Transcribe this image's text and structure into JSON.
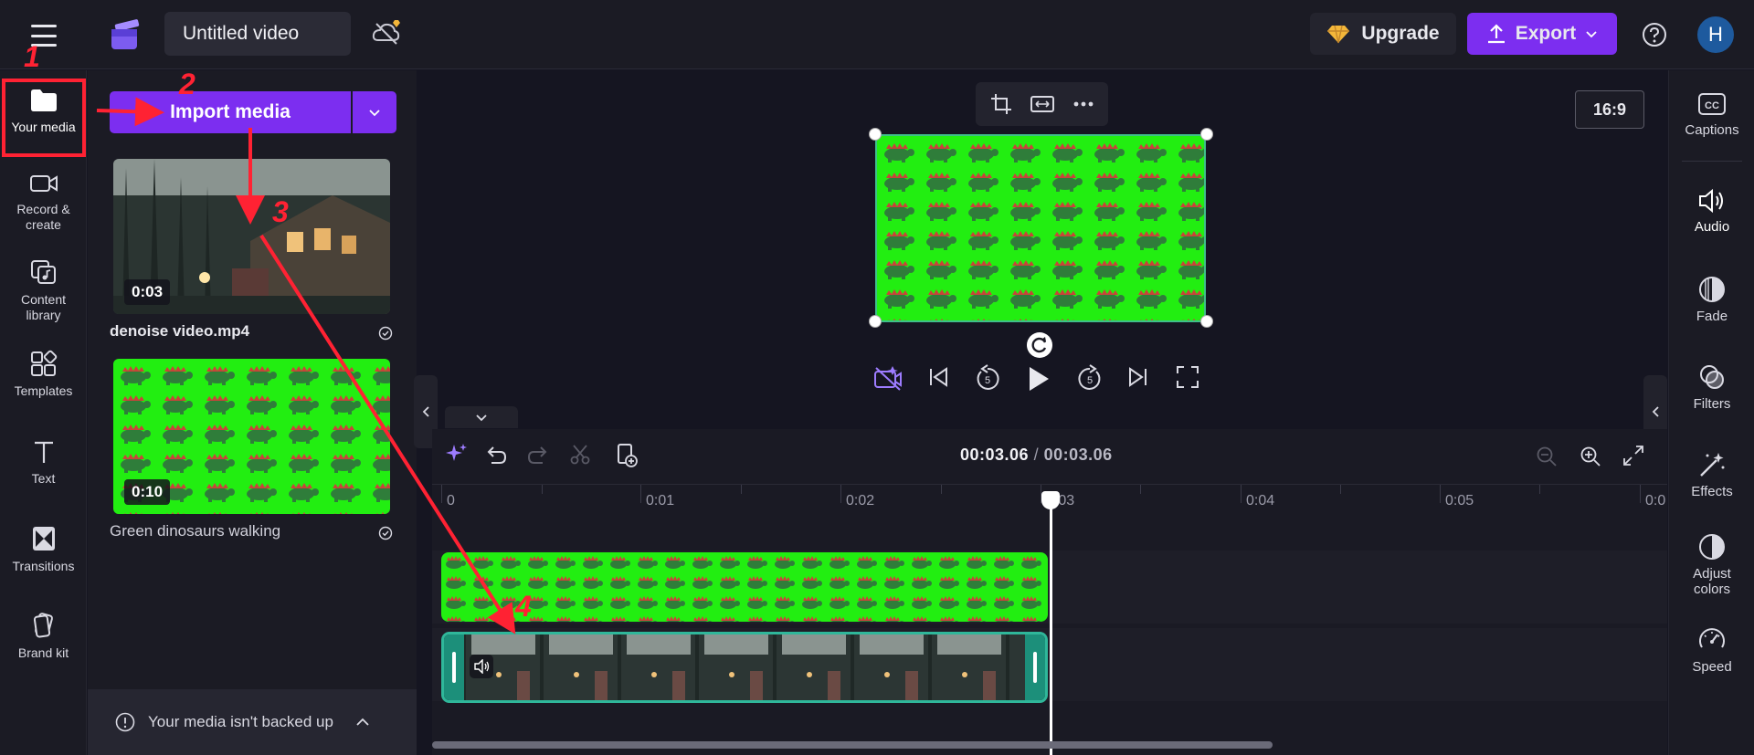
{
  "topbar": {
    "project_title": "Untitled video",
    "upgrade_label": "Upgrade",
    "export_label": "Export",
    "avatar_initial": "H"
  },
  "left_nav": {
    "items": [
      {
        "label": "Your media",
        "icon": "folder-icon",
        "active": true
      },
      {
        "label": "Record & create",
        "icon": "camera-icon"
      },
      {
        "label": "Content library",
        "icon": "library-icon"
      },
      {
        "label": "Templates",
        "icon": "templates-icon"
      },
      {
        "label": "Text",
        "icon": "text-icon"
      },
      {
        "label": "Transitions",
        "icon": "transitions-icon"
      },
      {
        "label": "Brand kit",
        "icon": "brand-kit-icon"
      }
    ]
  },
  "media_panel": {
    "import_label": "Import media",
    "items": [
      {
        "name": "denoise video.mp4",
        "duration": "0:03",
        "bold": true
      },
      {
        "name": "Green dinosaurs walking",
        "duration": "0:10",
        "bold": false
      }
    ],
    "backup_text": "Your media isn't backed up"
  },
  "preview": {
    "aspect_ratio": "16:9"
  },
  "timeline": {
    "current_time": "00:03.06",
    "separator": "/",
    "total_time": "00:03.06",
    "ruler_labels": [
      "0",
      "0:01",
      "0:02",
      "0:03",
      "0:04",
      "0:05",
      "0:0"
    ]
  },
  "right_bar": {
    "items": [
      {
        "label": "Captions",
        "icon": "captions-icon"
      },
      {
        "label": "Audio",
        "icon": "audio-icon",
        "active": true
      },
      {
        "label": "Fade",
        "icon": "fade-icon"
      },
      {
        "label": "Filters",
        "icon": "filters-icon"
      },
      {
        "label": "Effects",
        "icon": "effects-icon"
      },
      {
        "label": "Adjust colors",
        "icon": "adjust-colors-icon"
      },
      {
        "label": "Speed",
        "icon": "speed-icon"
      }
    ]
  },
  "annotations": [
    "1",
    "2",
    "3",
    "4"
  ],
  "colors": {
    "accent": "#7c2ef0",
    "annotation": "#ff2233",
    "clip_border": "#2fb79a",
    "dino_green": "#22ee11"
  }
}
